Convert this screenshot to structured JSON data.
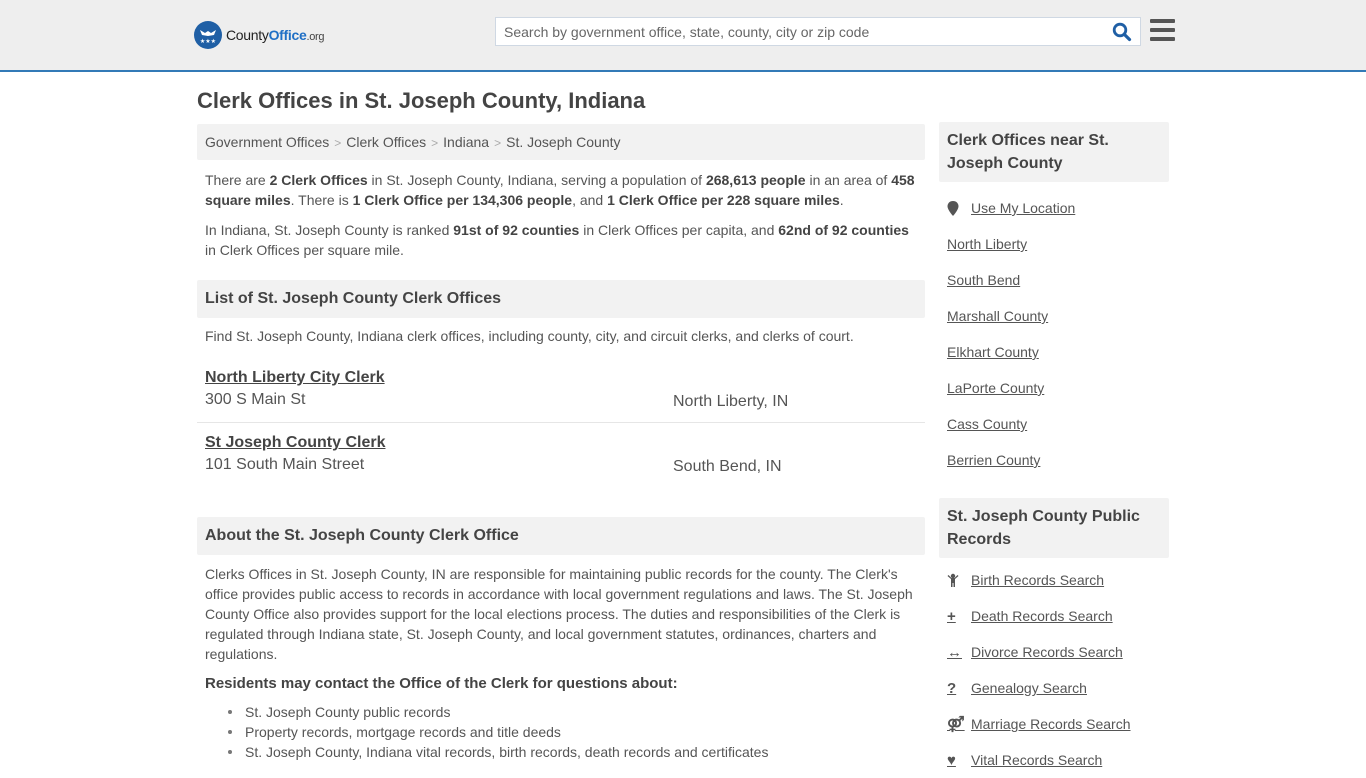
{
  "header": {
    "logo": {
      "prefix": "County",
      "brand": "Office",
      "tld": ".org"
    },
    "search": {
      "placeholder": "Search by government office, state, county, city or zip code",
      "value": ""
    },
    "colors": {
      "accent": "#337ab7",
      "brand": "#1f6fc5",
      "header_bg": "#eeeeee"
    }
  },
  "page": {
    "title": "Clerk Offices in St. Joseph County, Indiana"
  },
  "breadcrumb": [
    {
      "label": "Government Offices"
    },
    {
      "label": "Clerk Offices"
    },
    {
      "label": "Indiana"
    },
    {
      "label": "St. Joseph County"
    }
  ],
  "summary": {
    "p1": {
      "t1": "There are ",
      "b1": "2 Clerk Offices",
      "t2": " in St. Joseph County, Indiana, serving a population of ",
      "b2": "268,613 people",
      "t3": " in an area of ",
      "b3": "458 square miles",
      "t4": ". There is ",
      "b4": "1 Clerk Office per 134,306 people",
      "t5": ", and ",
      "b5": "1 Clerk Office per 228 square miles",
      "t6": "."
    },
    "p2": {
      "t1": "In Indiana, St. Joseph County is ranked ",
      "b1": "91st of 92 counties",
      "t2": " in Clerk Offices per capita, and ",
      "b2": "62nd of 92 counties",
      "t3": " in Clerk Offices per square mile."
    }
  },
  "list": {
    "heading": "List of St. Joseph County Clerk Offices",
    "description": "Find St. Joseph County, Indiana clerk offices, including county, city, and circuit clerks, and clerks of court.",
    "offices": [
      {
        "name": "North Liberty City Clerk",
        "address": "300 S Main St",
        "city": "North Liberty, IN"
      },
      {
        "name": "St Joseph County Clerk",
        "address": "101 South Main Street",
        "city": "South Bend, IN"
      }
    ]
  },
  "about": {
    "heading": "About the St. Joseph County Clerk Office",
    "body": "Clerks Offices in St. Joseph County, IN are responsible for maintaining public records for the county. The Clerk's office provides public access to records in accordance with local government regulations and laws. The St. Joseph County Office also provides support for the local elections process. The duties and responsibilities of the Clerk is regulated through Indiana state, St. Joseph County, and local government statutes, ordinances, charters and regulations.",
    "residents_heading": "Residents may contact the Office of the Clerk for questions about:",
    "bullets": [
      "St. Joseph County public records",
      "Property records, mortgage records and title deeds",
      "St. Joseph County, Indiana vital records, birth records, death records and certificates"
    ]
  },
  "sidebar": {
    "nearby": {
      "heading": "Clerk Offices near St. Joseph County",
      "use_location": {
        "label": "Use My Location",
        "icon": "map-marker-icon"
      },
      "links": [
        {
          "label": "North Liberty"
        },
        {
          "label": "South Bend"
        },
        {
          "label": "Marshall County"
        },
        {
          "label": "Elkhart County"
        },
        {
          "label": "LaPorte County"
        },
        {
          "label": "Cass County"
        },
        {
          "label": "Berrien County"
        }
      ]
    },
    "records": {
      "heading": "St. Joseph County Public Records",
      "links": [
        {
          "label": "Birth Records Search",
          "icon": "baby-icon",
          "glyph": "Ÿ"
        },
        {
          "label": "Death Records Search",
          "icon": "cross-icon",
          "glyph": "+"
        },
        {
          "label": "Divorce Records Search",
          "icon": "arrows-horizontal-icon",
          "glyph": "↔"
        },
        {
          "label": "Genealogy Search",
          "icon": "question-icon",
          "glyph": "?"
        },
        {
          "label": "Marriage Records Search",
          "icon": "venus-mars-icon",
          "glyph": "⚤"
        },
        {
          "label": "Vital Records Search",
          "icon": "heartbeat-icon",
          "glyph": "♥"
        }
      ]
    }
  }
}
